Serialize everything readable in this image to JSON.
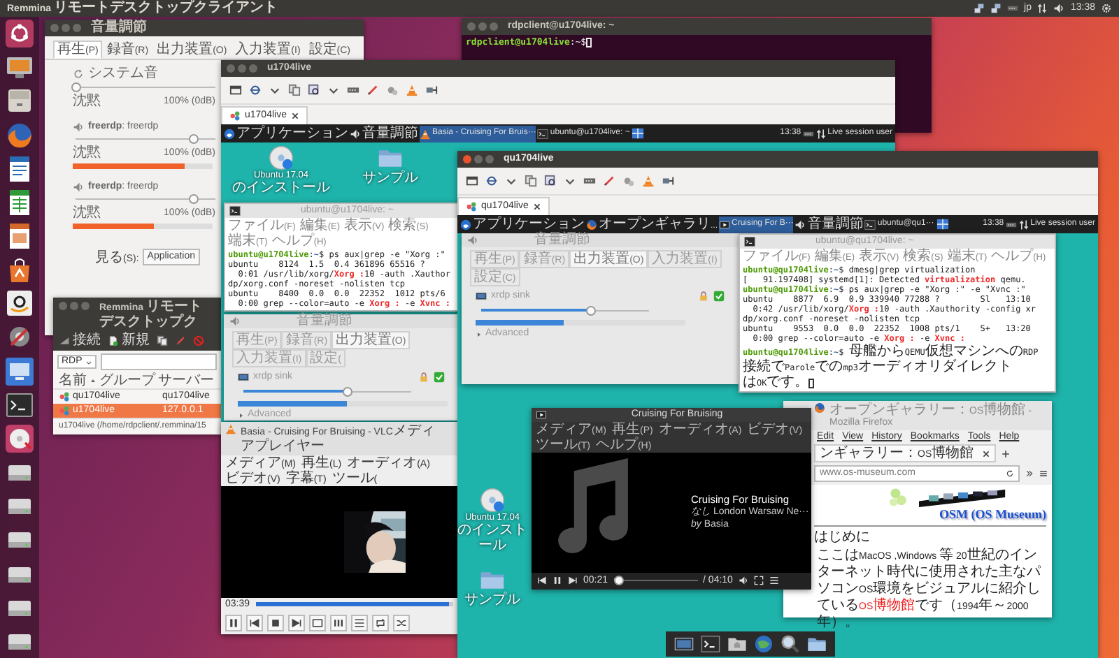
{
  "top_bar": {
    "title": "Remmina リモートデスクトップクライアント",
    "keyboard": "jp",
    "clock": "13:38"
  },
  "sound_window": {
    "title": "音量調節",
    "tabs": [
      {
        "label": "再生(P)",
        "selected": true
      },
      {
        "label": "録音(R)",
        "selected": false
      },
      {
        "label": "出力装置(O)",
        "selected": false
      },
      {
        "label": "入力装置(I)",
        "selected": false
      },
      {
        "label": "設定(C)",
        "selected": false
      }
    ],
    "streams": [
      {
        "kind": "system",
        "name": "システム音",
        "volume": {
          "level": 0
        },
        "low": "沈黙",
        "high": "100% (0dB)"
      },
      {
        "kind": "app",
        "name": "freerdp",
        "detail": ": freerdp",
        "volume": {
          "level": 0.84
        },
        "meter": {
          "level": 0.8
        },
        "low": "沈黙",
        "high": "100% (0dB)"
      },
      {
        "kind": "app",
        "name": "freerdp",
        "detail": ": freerdp",
        "volume": {
          "level": 0.84
        },
        "meter": {
          "level": 0.58
        },
        "low": "沈黙",
        "high": "100% (0dB)"
      }
    ],
    "view_label": "見る(S):",
    "view_value": "Application"
  },
  "host_terminal": {
    "title": "rdpclient@u1704live: ~",
    "prompt": "rdpclient@u1704live",
    "prompt_end": ":~$"
  },
  "remmina_window": {
    "title": "Remmina リモートデスクトップク",
    "buttons": [
      "接続",
      "新規"
    ],
    "protocol": "RDP",
    "columns": [
      "名前",
      "グループ",
      "サーバー"
    ],
    "rows": [
      {
        "name": "qu1704live",
        "server": "qu1704live",
        "selected": false
      },
      {
        "name": "u1704live",
        "server": "127.0.0.1",
        "selected": true
      }
    ],
    "status": "u1704live (/home/rdpclient/.remmina/15"
  },
  "u1704live_window": {
    "title": "u1704live",
    "tab": "u1704live",
    "panel": {
      "items": [
        {
          "kind": "menu",
          "label": "アプリケーション",
          "selected": false
        },
        {
          "kind": "mixer",
          "label": "音量調節",
          "selected": false
        },
        {
          "kind": "vlc",
          "label": "Basia - Cruising For Bruis···",
          "selected": true
        },
        {
          "kind": "terminal",
          "label": "ubuntu@u1704live: ~",
          "selected": false
        }
      ],
      "clock": "13:38",
      "user": "Live session user"
    },
    "desktop_icons": [
      {
        "kind": "disc",
        "label": "Ubuntu 17.04 のインストール"
      },
      {
        "kind": "folder",
        "label": "サンプル"
      }
    ],
    "terminal": {
      "title": "ubuntu@u1704live: ~",
      "menu": [
        "ファイル(F)",
        "編集(E)",
        "表示(V)",
        "検索(S)",
        "端末(T)",
        "ヘルプ(H)"
      ],
      "lines": [
        [
          {
            "kind": "prompt",
            "text": "ubuntu@u1704live"
          },
          {
            "kind": "plain",
            "text": ":"
          },
          {
            "kind": "path",
            "text": "~"
          },
          {
            "kind": "plain",
            "text": "$ ps aux|grep -e \"Xorg :\""
          }
        ],
        [
          {
            "kind": "plain",
            "text": "ubuntu    8124  1.5  0.4 361896 65516 ?"
          }
        ],
        [
          {
            "kind": "plain",
            "text": "  0:01 /usr/lib/xorg/"
          },
          {
            "kind": "match",
            "text": "Xorg :"
          },
          {
            "kind": "plain",
            "text": "10 -auth .Xauthor"
          }
        ],
        [
          {
            "kind": "plain",
            "text": "dp/xorg.conf -noreset -nolisten tcp"
          }
        ],
        [
          {
            "kind": "plain",
            "text": "ubuntu    8400  0.0  0.0  22352  1012 pts/6"
          }
        ],
        [
          {
            "kind": "plain",
            "text": "  0:00 grep --color=auto -e "
          },
          {
            "kind": "match",
            "text": "Xorg :"
          },
          {
            "kind": "plain",
            "text": " -e "
          },
          {
            "kind": "match",
            "text": "Xvnc :"
          }
        ]
      ]
    },
    "mixer": {
      "title": "音量調節",
      "tabs": [
        {
          "label": "再生(P)",
          "selected": false
        },
        {
          "label": "録音(R)",
          "selected": false
        },
        {
          "label": "出力装置(O)",
          "selected": true
        },
        {
          "label": "入力装置(I)",
          "selected": false
        },
        {
          "label": "設定(",
          "selected": false
        }
      ],
      "sink": "xrdp sink",
      "volume": {
        "level": 0.62
      },
      "meter": {
        "level": 0.52
      },
      "advanced": "Advanced"
    },
    "vlc": {
      "title": "Basia - Cruising For Bruising - VLCメディアプレイヤー",
      "menu": [
        "メディア(M)",
        "再生(L)",
        "オーディオ(A)",
        "ビデオ(V)",
        "字幕(T)",
        "ツール("
      ],
      "time": "03:39",
      "progress": {
        "level": 0.98
      }
    }
  },
  "qu1704live_window": {
    "title": "qu1704live",
    "tab": "qu1704live",
    "panel": {
      "items": [
        {
          "kind": "menu",
          "label": "アプリケーション",
          "selected": false
        },
        {
          "kind": "browser",
          "label": "オープンギャラリ...",
          "selected": false
        },
        {
          "kind": "player",
          "label": "Cruising For B···",
          "selected": true
        },
        {
          "kind": "mixer",
          "label": "音量調節",
          "selected": false
        },
        {
          "kind": "terminal",
          "label": "ubuntu@qu1···",
          "selected": false
        }
      ],
      "clock": "13:38",
      "user": "Live session user"
    },
    "mixer": {
      "title": "音量調節",
      "tabs": [
        {
          "label": "再生(P)",
          "selected": false
        },
        {
          "label": "録音(R)",
          "selected": false
        },
        {
          "label": "出力装置(O)",
          "selected": true
        },
        {
          "label": "入力装置(I)",
          "selected": false
        },
        {
          "label": "設定(C)",
          "selected": false
        }
      ],
      "sink": "xrdp sink",
      "volume": {
        "level": 0.65
      },
      "meter": {
        "level": 0.42
      },
      "advanced": "Advanced"
    },
    "terminal": {
      "title": "ubuntu@qu1704live: ~",
      "menu": [
        "ファイル(F)",
        "編集(E)",
        "表示(V)",
        "検索(S)",
        "端末(T)",
        "ヘルプ(H)"
      ],
      "lines": [
        [
          {
            "kind": "prompt",
            "text": "ubuntu@qu1704live"
          },
          {
            "kind": "plain",
            "text": ":"
          },
          {
            "kind": "path",
            "text": "~"
          },
          {
            "kind": "plain",
            "text": "$ dmesg|grep virtualization"
          }
        ],
        [
          {
            "kind": "plain",
            "text": "[   91.197408] systemd[1]: Detected "
          },
          {
            "kind": "match",
            "text": "virtualization"
          },
          {
            "kind": "plain",
            "text": " qemu."
          }
        ],
        [
          {
            "kind": "prompt",
            "text": "ubuntu@qu1704live"
          },
          {
            "kind": "plain",
            "text": ":"
          },
          {
            "kind": "path",
            "text": "~"
          },
          {
            "kind": "plain",
            "text": "$ ps aux|grep -e \"Xorg :\" -e \"Xvnc :\""
          }
        ],
        [
          {
            "kind": "plain",
            "text": "ubuntu    8877  6.9  0.9 339940 77288 ?        Sl   13:10"
          }
        ],
        [
          {
            "kind": "plain",
            "text": "  0:42 /usr/lib/xorg/"
          },
          {
            "kind": "match",
            "text": "Xorg :"
          },
          {
            "kind": "plain",
            "text": "10 -auth .Xauthority -config xr"
          }
        ],
        [
          {
            "kind": "plain",
            "text": "dp/xorg.conf -noreset -nolisten tcp"
          }
        ],
        [
          {
            "kind": "plain",
            "text": "ubuntu    9553  0.0  0.0  22352  1008 pts/1    S+   13:20"
          }
        ],
        [
          {
            "kind": "plain",
            "text": "  0:00 grep --color=auto -e "
          },
          {
            "kind": "match",
            "text": "Xorg :"
          },
          {
            "kind": "plain",
            "text": " -e "
          },
          {
            "kind": "match",
            "text": "Xvnc :"
          }
        ],
        [
          {
            "kind": "prompt",
            "text": "ubuntu@qu1704live"
          },
          {
            "kind": "plain",
            "text": ":"
          },
          {
            "kind": "path",
            "text": "~"
          },
          {
            "kind": "plain",
            "text": "$ 母艦からQEMU仮想マシンへのRDP"
          }
        ],
        [
          {
            "kind": "plain",
            "text": "接続でParoleでのmp3オーディオリダイレクト"
          }
        ],
        [
          {
            "kind": "plain",
            "text": "はOKです。"
          }
        ]
      ]
    },
    "firefox": {
      "title": "オープンギャラリー：OS博物館 - Mozilla Firefox",
      "menu": [
        "Edit",
        "View",
        "History",
        "Bookmarks",
        "Tools",
        "Help"
      ],
      "tab": "ンギャラリー：OS博物館",
      "url": "www.os-museum.com",
      "heading": "OSM (OS Museum)",
      "section": "はじめに",
      "paragraph": [
        {
          "kind": "plain",
          "text": "ここはMacOS ,Windows 等 20世紀のインターネット時代に使用された主なパソコンOS環境をビジュアルに紹介している"
        },
        {
          "kind": "link",
          "text": "OS博物館"
        },
        {
          "kind": "plain",
          "text": "です（1994年～2000年）。"
        }
      ]
    },
    "parole": {
      "title": "Cruising For Bruising",
      "menu": [
        "メディア(M)",
        "再生(P)",
        "オーディオ(A)",
        "ビデオ(V)",
        "ツール(T)",
        "ヘルプ(H)"
      ],
      "track": "Cruising For Bruising",
      "album": "*なし* London Warsaw Ne···",
      "artist": "*by* Basia",
      "position": "00:21",
      "duration": "/ 04:10",
      "progress": {
        "level": 0.06
      }
    },
    "desktop_icons": [
      {
        "kind": "disc",
        "label": "Ubuntu 17.04 のインストール"
      },
      {
        "kind": "folder",
        "label": "サンプル"
      }
    ]
  }
}
